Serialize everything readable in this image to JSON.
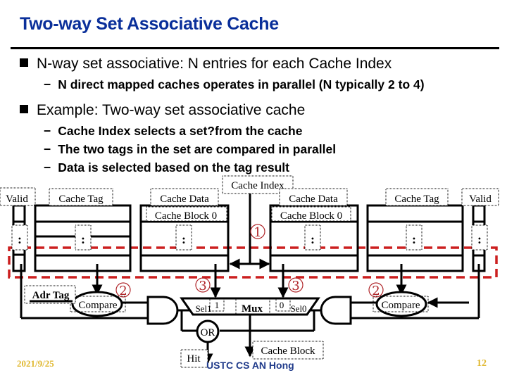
{
  "slide": {
    "title": "Two-way Set Associative Cache",
    "bullets": [
      {
        "text": "N-way set associative: N entries for each Cache Index",
        "sub": [
          "N direct mapped caches operates in parallel (N typically 2 to 4)"
        ]
      },
      {
        "text": "Example: Two-way set associative cache",
        "sub": [
          "Cache Index selects a set?from the cache",
          "The two tags in the set are compared in parallel",
          "Data is selected based on the tag result"
        ]
      }
    ],
    "dash": "−"
  },
  "diagram": {
    "labels": {
      "valid_left": "Valid",
      "cache_tag_left": "Cache Tag",
      "cache_data_left": "Cache Data",
      "cache_block0_left": "Cache Block 0",
      "cache_index": "Cache Index",
      "cache_data_right": "Cache Data",
      "cache_block0_right": "Cache Block 0",
      "cache_tag_right": "Cache Tag",
      "valid_right": "Valid",
      "ellipsis": ":",
      "adr_tag": "Adr Tag",
      "compare_left": "Compare",
      "compare_right": "Compare",
      "sel1": "Sel1",
      "sel1_value": "1",
      "mux": "Mux",
      "sel0_value": "0",
      "sel0": "Sel0",
      "or_gate": "OR",
      "hit": "Hit",
      "cache_block_out": "Cache Block"
    },
    "step_markers": {
      "step1": "①",
      "step2_left": "②",
      "step2_right": "②",
      "step3_left": "③",
      "step3_right": "③"
    },
    "colors": {
      "highlight_dash": "#cc1f1f",
      "step_marker": "#b0262a",
      "lines": "#000000"
    }
  },
  "footer": {
    "date": "2021/9/25",
    "author": "USTC CS AN Hong",
    "page": "12"
  },
  "colors": {
    "title": "#0a2f9a",
    "footer_date": "#e0b830",
    "footer_author": "#1f3a8a"
  }
}
